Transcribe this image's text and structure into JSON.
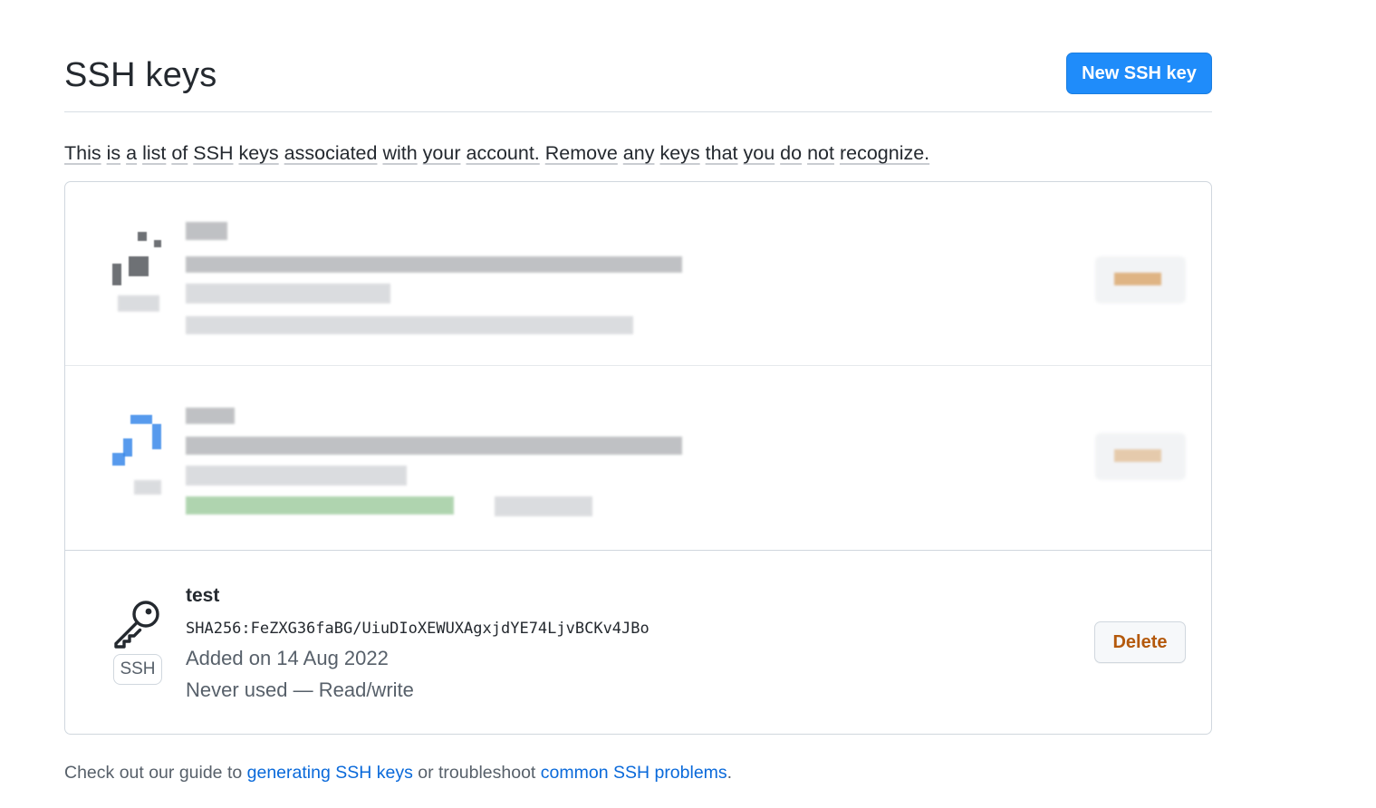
{
  "header": {
    "title": "SSH keys",
    "new_button_label": "New SSH key"
  },
  "intro": {
    "words": [
      "This",
      "is",
      "a",
      "list",
      "of",
      "SSH",
      "keys",
      "associated",
      "with",
      "your",
      "account.",
      "Remove",
      "any",
      "keys",
      "that",
      "you",
      "do",
      "not",
      "recognize."
    ]
  },
  "keys": [
    {
      "title": "test",
      "fingerprint": "SHA256:FeZXG36faBG/UiuDIoXEWUXAgxjdYE74LjvBCKv4JBo",
      "added": "Added on 14 Aug 2022",
      "usage": "Never used — Read/write",
      "type_badge": "SSH",
      "delete_label": "Delete",
      "icon": "key-icon"
    }
  ],
  "footer": {
    "prefix": "Check out our guide to",
    "link1": "generating SSH keys",
    "middle": "or troubleshoot",
    "link2": "common SSH problems",
    "suffix": "."
  },
  "colors": {
    "primary_button": "#1f8cfa",
    "danger_text": "#b4590c",
    "link": "#0969da"
  }
}
